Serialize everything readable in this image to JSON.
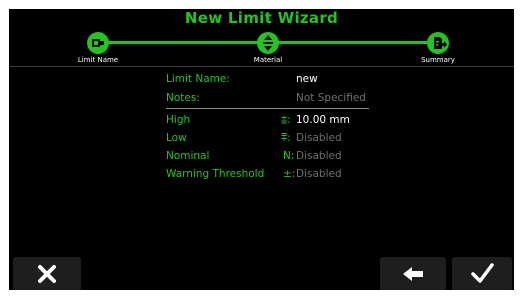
{
  "wizard": {
    "title": "New Limit Wizard",
    "steps": [
      {
        "label": "Limit Name",
        "icon": "limit-name-icon"
      },
      {
        "label": "Material",
        "icon": "material-icon"
      },
      {
        "label": "Summary",
        "icon": "summary-icon"
      }
    ]
  },
  "summary": {
    "limit_name_label": "Limit Name:",
    "limit_name_value": "new",
    "notes_label": "Notes:",
    "notes_value": "Not Specified",
    "fields": [
      {
        "label": "High",
        "symbol": "⩲:",
        "value": "10.00 mm",
        "state": "set"
      },
      {
        "label": "Low",
        "symbol": "⩱:",
        "value": "Disabled",
        "state": "disabled"
      },
      {
        "label": "Nominal",
        "symbol": "N:",
        "value": "Disabled",
        "state": "disabled"
      },
      {
        "label": "Warning Threshold",
        "symbol": "±:",
        "value": "Disabled",
        "state": "disabled"
      }
    ]
  },
  "buttons": {
    "cancel_icon": "close-icon",
    "back_icon": "arrow-left-icon",
    "confirm_icon": "checkmark-icon"
  },
  "colors": {
    "accent": "#22c51d",
    "background": "#000000",
    "value_text": "#ffffff",
    "disabled_text": "#6f6f6f",
    "button_bg": "#1e1e1e"
  }
}
